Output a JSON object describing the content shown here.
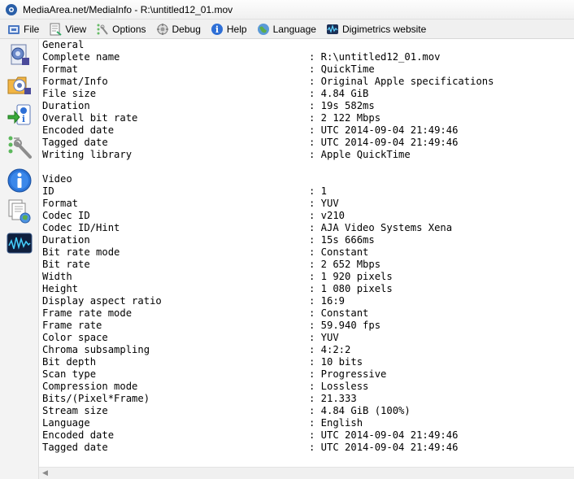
{
  "window": {
    "title": "MediaArea.net/MediaInfo - R:\\untitled12_01.mov"
  },
  "menu": [
    {
      "label": "File",
      "icon": "file-icon"
    },
    {
      "label": "View",
      "icon": "view-icon"
    },
    {
      "label": "Options",
      "icon": "options-icon"
    },
    {
      "label": "Debug",
      "icon": "debug-icon"
    },
    {
      "label": "Help",
      "icon": "help-icon"
    },
    {
      "label": "Language",
      "icon": "language-icon"
    },
    {
      "label": "Digimetrics website",
      "icon": "digimetrics-icon"
    }
  ],
  "sidebar": [
    {
      "icon": "open-file-icon"
    },
    {
      "icon": "open-folder-icon"
    },
    {
      "icon": "export-icon"
    },
    {
      "icon": "preferences-icon"
    },
    {
      "icon": "about-icon"
    },
    {
      "icon": "view-sheet-icon"
    },
    {
      "icon": "digimetrics-logo-icon"
    }
  ],
  "info": [
    {
      "key": "General",
      "value": ""
    },
    {
      "key": "Complete name",
      "value": ": R:\\untitled12_01.mov"
    },
    {
      "key": "Format",
      "value": ": QuickTime"
    },
    {
      "key": "Format/Info",
      "value": ": Original Apple specifications"
    },
    {
      "key": "File size",
      "value": ": 4.84 GiB"
    },
    {
      "key": "Duration",
      "value": ": 19s 582ms"
    },
    {
      "key": "Overall bit rate",
      "value": ": 2 122 Mbps"
    },
    {
      "key": "Encoded date",
      "value": ": UTC 2014-09-04 21:49:46"
    },
    {
      "key": "Tagged date",
      "value": ": UTC 2014-09-04 21:49:46"
    },
    {
      "key": "Writing library",
      "value": ": Apple QuickTime"
    },
    {
      "key": "",
      "value": ""
    },
    {
      "key": "Video",
      "value": ""
    },
    {
      "key": "ID",
      "value": ": 1"
    },
    {
      "key": "Format",
      "value": ": YUV"
    },
    {
      "key": "Codec ID",
      "value": ": v210"
    },
    {
      "key": "Codec ID/Hint",
      "value": ": AJA Video Systems Xena"
    },
    {
      "key": "Duration",
      "value": ": 15s 666ms"
    },
    {
      "key": "Bit rate mode",
      "value": ": Constant"
    },
    {
      "key": "Bit rate",
      "value": ": 2 652 Mbps"
    },
    {
      "key": "Width",
      "value": ": 1 920 pixels"
    },
    {
      "key": "Height",
      "value": ": 1 080 pixels"
    },
    {
      "key": "Display aspect ratio",
      "value": ": 16:9"
    },
    {
      "key": "Frame rate mode",
      "value": ": Constant"
    },
    {
      "key": "Frame rate",
      "value": ": 59.940 fps"
    },
    {
      "key": "Color space",
      "value": ": YUV"
    },
    {
      "key": "Chroma subsampling",
      "value": ": 4:2:2"
    },
    {
      "key": "Bit depth",
      "value": ": 10 bits"
    },
    {
      "key": "Scan type",
      "value": ": Progressive"
    },
    {
      "key": "Compression mode",
      "value": ": Lossless"
    },
    {
      "key": "Bits/(Pixel*Frame)",
      "value": ": 21.333"
    },
    {
      "key": "Stream size",
      "value": ": 4.84 GiB (100%)"
    },
    {
      "key": "Language",
      "value": ": English"
    },
    {
      "key": "Encoded date",
      "value": ": UTC 2014-09-04 21:49:46"
    },
    {
      "key": "Tagged date",
      "value": ": UTC 2014-09-04 21:49:46"
    }
  ]
}
